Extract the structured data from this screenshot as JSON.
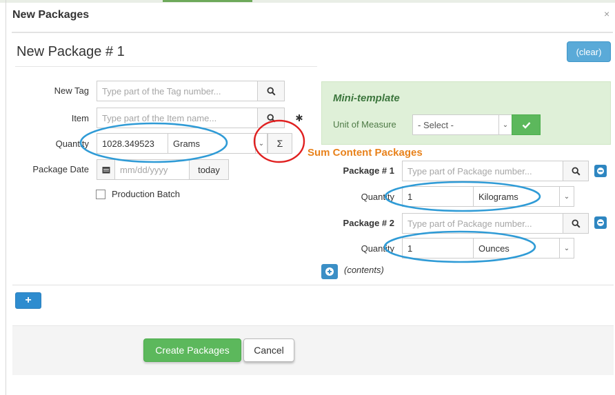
{
  "dialog": {
    "title": "New Packages",
    "close": "×"
  },
  "package": {
    "title": "New Package # 1",
    "clear_label": "(clear)"
  },
  "form": {
    "tag_label": "New Tag",
    "tag_placeholder": "Type part of the Tag number...",
    "item_label": "Item",
    "item_placeholder": "Type part of the Item name...",
    "quantity_label": "Quantity",
    "quantity_value": "1028.349523",
    "quantity_unit": "Grams",
    "date_label": "Package Date",
    "date_placeholder": "mm/dd/yyyy",
    "today_label": "today",
    "production_batch_label": "Production Batch"
  },
  "mini_template": {
    "title": "Mini-template",
    "uom_label": "Unit of Measure",
    "uom_value": "- Select -"
  },
  "annotation": {
    "sum_label": "Sum Content Packages",
    "sum_symbol": "Σ"
  },
  "contents": {
    "packages": [
      {
        "label": "Package # 1",
        "placeholder": "Type part of Package number...",
        "quantity_label": "Quantity",
        "quantity": "1",
        "unit": "Kilograms"
      },
      {
        "label": "Package # 2",
        "placeholder": "Type part of Package number...",
        "quantity_label": "Quantity",
        "quantity": "1",
        "unit": "Ounces"
      }
    ],
    "contents_label": "(contents)"
  },
  "footer": {
    "add_label": "+",
    "create_label": "Create Packages",
    "cancel_label": "Cancel"
  },
  "colors": {
    "primary": "#2e8ccf",
    "success": "#5cb85c",
    "annotation_blue": "#2f9bd6",
    "annotation_red": "#e02020",
    "annotation_orange": "#e8821c"
  }
}
